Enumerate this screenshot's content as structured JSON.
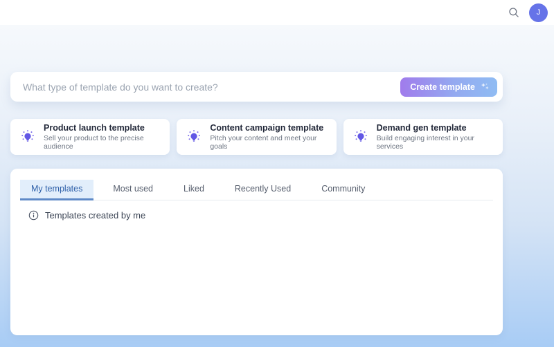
{
  "topbar": {
    "avatar_initial": "J"
  },
  "search": {
    "placeholder": "What type of template do you want to create?",
    "button_label": "Create template"
  },
  "cards": [
    {
      "title": "Product launch template",
      "subtitle": "Sell your product to the precise audience"
    },
    {
      "title": "Content campaign template",
      "subtitle": "Pitch your content and meet your goals"
    },
    {
      "title": "Demand gen template",
      "subtitle": "Build engaging interest in your services"
    }
  ],
  "tabs": [
    {
      "label": "My templates",
      "active": true
    },
    {
      "label": "Most used",
      "active": false
    },
    {
      "label": "Liked",
      "active": false
    },
    {
      "label": "Recently Used",
      "active": false
    },
    {
      "label": "Community",
      "active": false
    }
  ],
  "panel": {
    "empty_state": "Templates created by me"
  },
  "icons": {
    "topbar_search": "search-icon",
    "button_icon": "sparkles-icon",
    "card_icon": "lightbulb-icon",
    "empty_state_icon": "info-icon"
  },
  "colors": {
    "avatar_bg": "#6673e8",
    "button_gradient_start": "#a07bec",
    "button_gradient_end": "#8fbcf3",
    "active_tab_text": "#2d5fa8",
    "active_tab_underline": "#5e89c7",
    "active_tab_bg": "#e2eefb",
    "lightbulb_purple": "#6257e5",
    "page_gradient_bottom": "#a8ccf5"
  }
}
